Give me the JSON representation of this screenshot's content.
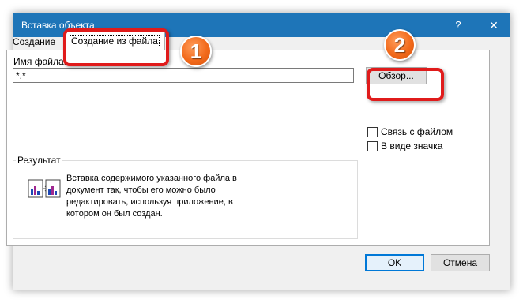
{
  "window": {
    "title": "Вставка объекта",
    "help": "?",
    "close": "✕"
  },
  "tabs": [
    {
      "label": "Создание"
    },
    {
      "label": "Создание из файла",
      "selected": true
    }
  ],
  "file": {
    "label": "Имя файла:",
    "value": "*.*",
    "browse_label": "Обзор..."
  },
  "options": {
    "link_label": "Связь с файлом",
    "icon_label": "В виде значка"
  },
  "result": {
    "title": "Результат",
    "text": "Вставка содержимого указанного файла в документ так, чтобы его можно было редактировать, используя приложение, в котором он был создан."
  },
  "buttons": {
    "ok": "OK",
    "cancel": "Отмена"
  },
  "annotations": [
    {
      "number": "1"
    },
    {
      "number": "2"
    }
  ],
  "colors": {
    "titlebar": "#1e75b8",
    "callout": "#e01b1b",
    "badge": "#f26a1b"
  }
}
